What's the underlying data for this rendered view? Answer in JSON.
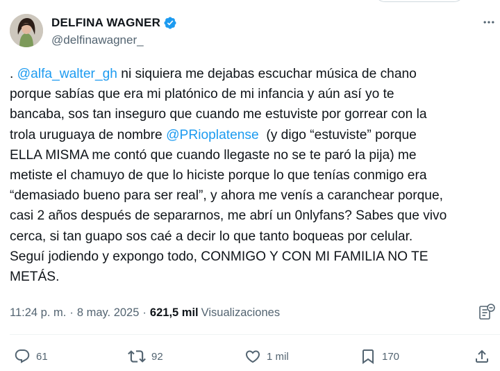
{
  "author": {
    "display_name": "DELFINA WAGNER",
    "handle": "@delfinawagner_",
    "verified": true
  },
  "tweet": {
    "lines": [
      [
        {
          "t": ". "
        },
        {
          "t": "@alfa_walter_gh",
          "m": true
        },
        {
          "t": " ni siquiera me dejabas escuchar música de chano"
        }
      ],
      [
        {
          "t": "porque sabías que era mi platónico de mi infancia y aún así yo te"
        }
      ],
      [
        {
          "t": "bancaba, sos tan inseguro que cuando me estuviste por gorrear con la"
        }
      ],
      [
        {
          "t": "trola uruguaya de nombre "
        },
        {
          "t": "@PRioplatense",
          "m": true
        },
        {
          "t": "  (y digo “estuviste” porque"
        }
      ],
      [
        {
          "t": "ELLA MISMA me contó que cuando llegaste no se te paró la pija) me"
        }
      ],
      [
        {
          "t": "metiste el chamuyo de que lo hiciste porque lo que tenías conmigo era"
        }
      ],
      [
        {
          "t": "“demasiado bueno para ser real”, y ahora me venís a caranchear porque,"
        }
      ],
      [
        {
          "t": "casi 2 años después de separarnos, me abrí un 0nlyfans? Sabes que vivo"
        }
      ],
      [
        {
          "t": "cerca, si tan guapo sos caé a decir lo que tanto boqueas por celular."
        }
      ],
      [
        {
          "t": "Seguí jodiendo y expongo todo, CONMIGO Y CON MI FAMILIA NO TE"
        }
      ],
      [
        {
          "t": "METÁS."
        }
      ]
    ]
  },
  "meta": {
    "time": "11:24 p. m.",
    "date": "8 may. 2025",
    "separator": "·",
    "views_count": "621,5 mil",
    "views_label": "Visualizaciones"
  },
  "actions": {
    "replies": "61",
    "reposts": "92",
    "likes": "1 mil",
    "bookmarks": "170"
  },
  "colors": {
    "accent": "#1d9bf0",
    "text": "#0f1419",
    "secondary": "#536471"
  },
  "icons": [
    "verified-badge-icon",
    "more-options-icon",
    "analytics-icon",
    "reply-icon",
    "repost-icon",
    "like-icon",
    "bookmark-icon",
    "share-icon"
  ]
}
